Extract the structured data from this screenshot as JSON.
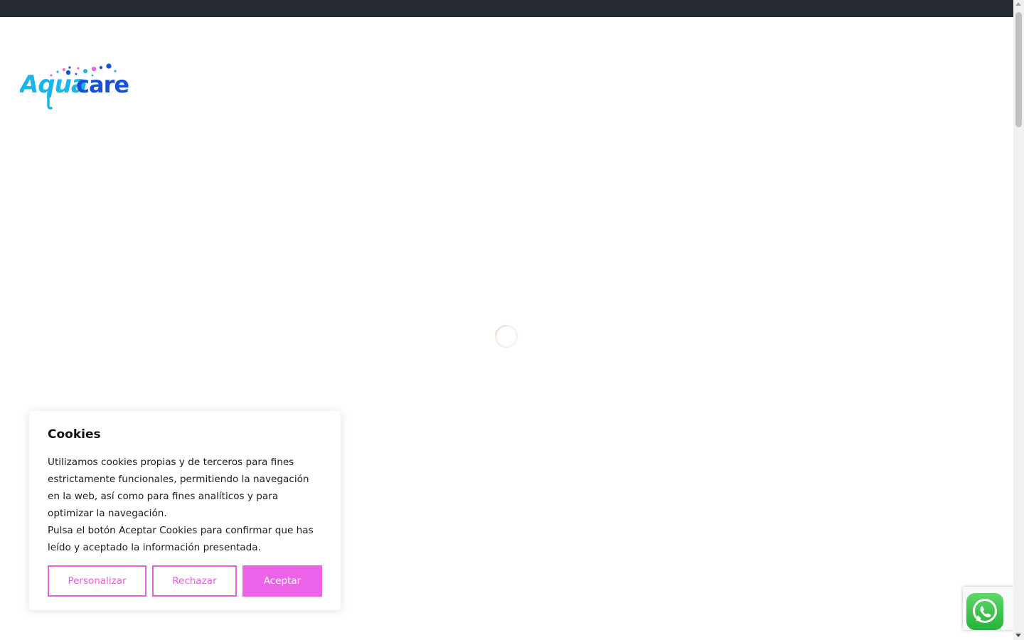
{
  "header": {
    "brand": "Aquacare"
  },
  "colors": {
    "topbar": "#262a33",
    "accent": "#ec63ea",
    "logo_light": "#19b6ec",
    "logo_dark": "#1550d8"
  },
  "cookie_banner": {
    "title": "Cookies",
    "paragraph_1": "Utilizamos cookies propias y de terceros para fines estrictamente funcionales, permitiendo la navegación en la web, así como para fines analíticos y para optimizar la navegación.",
    "paragraph_2": "Pulsa el botón Aceptar Cookies para confirmar que has leído y aceptado la información presentada.",
    "buttons": {
      "customize": "Personalizar",
      "reject": "Rechazar",
      "accept": "Aceptar"
    }
  },
  "floating": {
    "whatsapp_icon": "whatsapp-icon",
    "loading_indicator": "loading-spinner-icon"
  }
}
